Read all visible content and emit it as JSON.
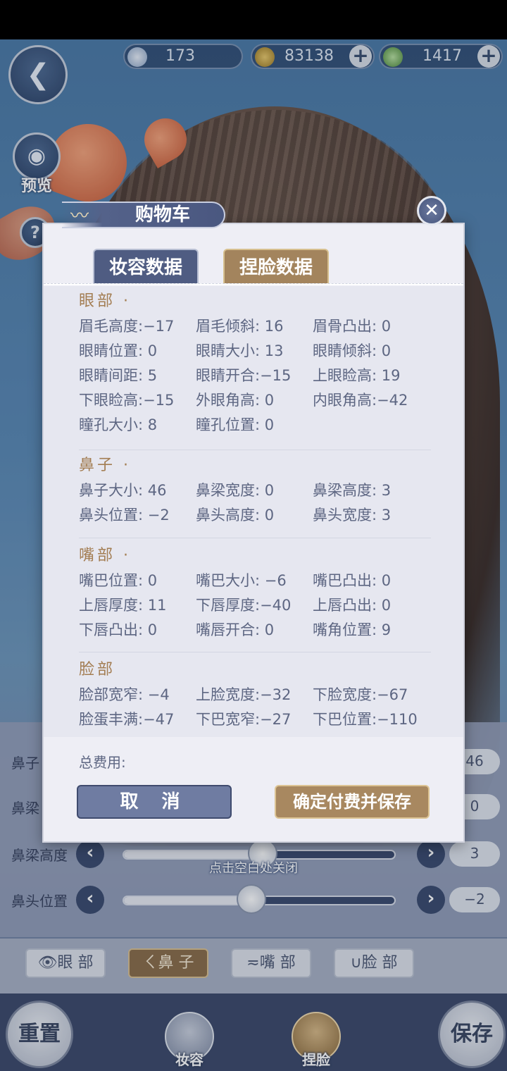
{
  "currency": {
    "silver": {
      "value": "173",
      "icon": "silver-coin-icon"
    },
    "copper": {
      "value": "83138",
      "icon": "copper-coin-icon"
    },
    "jade": {
      "value": "1417",
      "icon": "jade-coin-icon"
    },
    "add_symbol": "+"
  },
  "side_buttons": {
    "back_icon": "back-butterfly-icon",
    "preview_label": "预览",
    "help_symbol": "?"
  },
  "modal": {
    "title": "购物车",
    "close_symbol": "✕",
    "tabs": [
      {
        "label": "妆容数据",
        "active": false
      },
      {
        "label": "捏脸数据",
        "active": true
      }
    ],
    "sections": [
      {
        "title": "眼部 ·",
        "rows": [
          [
            "眉毛高度:−17",
            "眉毛倾斜: 16",
            "眉骨凸出:  0"
          ],
          [
            "眼睛位置:  0",
            "眼睛大小: 13",
            "眼睛倾斜:  0"
          ],
          [
            "眼睛间距:  5",
            "眼睛开合:−15",
            "上眼睑高: 19"
          ],
          [
            "下眼睑高:−15",
            "外眼角高:  0",
            "内眼角高:−42"
          ],
          [
            "瞳孔大小:  8",
            "瞳孔位置:  0",
            ""
          ]
        ]
      },
      {
        "title": "鼻子 ·",
        "rows": [
          [
            "鼻子大小: 46",
            "鼻梁宽度:  0",
            "鼻梁高度:  3"
          ],
          [
            "鼻头位置: −2",
            "鼻头高度:  0",
            "鼻头宽度:  3"
          ]
        ]
      },
      {
        "title": "嘴部 ·",
        "rows": [
          [
            "嘴巴位置:  0",
            "嘴巴大小: −6",
            "嘴巴凸出:  0"
          ],
          [
            "上唇厚度: 11",
            "下唇厚度:−40",
            "上唇凸出:  0"
          ],
          [
            "下唇凸出:  0",
            "嘴唇开合:  0",
            "嘴角位置:  9"
          ]
        ]
      },
      {
        "title": "脸部",
        "rows": [
          [
            "脸部宽窄: −4",
            "上脸宽度:−32",
            "下脸宽度:−67"
          ],
          [
            "脸蛋丰满:−47",
            "下巴宽窄:−27",
            "下巴位置:−110"
          ]
        ]
      }
    ],
    "total_label": "总费用:",
    "cancel_label": "取 消",
    "confirm_label": "确定付费并保存"
  },
  "background_panel": {
    "rows": [
      {
        "label": "鼻子",
        "value": "46"
      },
      {
        "label": "鼻梁",
        "value": "0"
      },
      {
        "label": "鼻梁高度",
        "value": "3",
        "level": 0.5
      },
      {
        "label": "鼻头位置",
        "value": "−2",
        "level": 0.47
      }
    ],
    "close_hint": "点击空白处关闭",
    "face_tabs": [
      {
        "label": "👁眼 部",
        "active": false
      },
      {
        "label": "ㄑ鼻 子",
        "active": true
      },
      {
        "label": "≂嘴 部",
        "active": false
      },
      {
        "label": "∪脸 部",
        "active": false
      }
    ]
  },
  "bottom_nav": {
    "reset_label": "重置",
    "makeup_label": "妆容",
    "face_label": "捏脸",
    "save_label": "保存"
  }
}
